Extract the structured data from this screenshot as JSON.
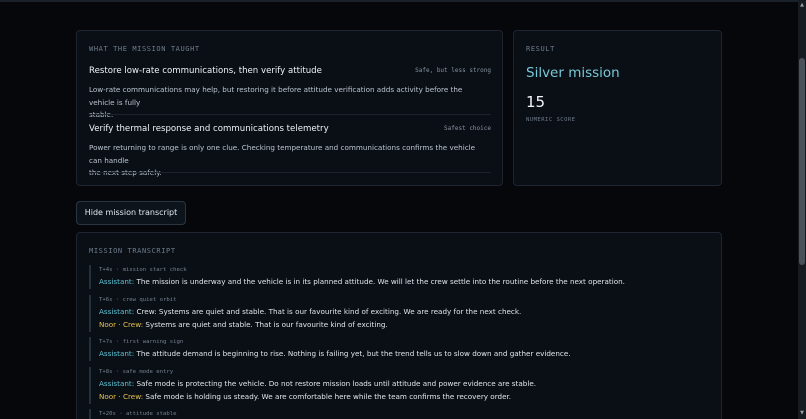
{
  "lessons_panel": {
    "label": "WHAT THE MISSION TAUGHT",
    "items": [
      {
        "title": "Restore low-rate communications, then verify attitude",
        "tag": "Safe, but less strong",
        "body_1": "Low-rate communications may help, but restoring it before attitude verification adds activity before the vehicle is fully",
        "body_2": "stable."
      },
      {
        "title": "Verify thermal response and communications telemetry",
        "tag": "Safest choice",
        "body_1": "Power returning to range is only one clue. Checking temperature and communications confirms the vehicle can handle",
        "body_2": "the next step safely."
      }
    ]
  },
  "result_panel": {
    "label": "RESULT",
    "title": "Silver mission",
    "score": "15",
    "score_label": "NUMERIC SCORE"
  },
  "transcript_toggle": {
    "label": "Hide mission transcript"
  },
  "transcript": {
    "label": "MISSION TRANSCRIPT",
    "entries": [
      {
        "time": "T+4s · mission start check",
        "lines": [
          {
            "speaker": "Assistant:",
            "text": " The mission is underway and the vehicle is in its planned attitude. We will let the crew settle into the routine before the next operation."
          }
        ]
      },
      {
        "time": "T+6s · crew quiet orbit",
        "lines": [
          {
            "speaker": "Assistant:",
            "text": " Crew: Systems are quiet and stable. That is our favourite kind of exciting. We are ready for the next check."
          },
          {
            "speaker": "Noor · Crew:",
            "text": " Systems are quiet and stable. That is our favourite kind of exciting."
          }
        ]
      },
      {
        "time": "T+7s · first warning sign",
        "lines": [
          {
            "speaker": "Assistant:",
            "text": " The attitude demand is beginning to rise. Nothing is failing yet, but the trend tells us to slow down and gather evidence."
          }
        ]
      },
      {
        "time": "T+8s · safe mode entry",
        "lines": [
          {
            "speaker": "Assistant:",
            "text": " Safe mode is protecting the vehicle. Do not restore mission loads until attitude and power evidence are stable."
          },
          {
            "speaker": "Noor · Crew:",
            "text": " Safe mode is holding us steady. We are comfortable here while the team confirms the recovery order."
          }
        ]
      },
      {
        "time": "T+20s · attitude stable",
        "lines": []
      }
    ]
  },
  "colors": {
    "assistant": "#5ec4d6",
    "crew": "#e3c24d",
    "result_title": "#79c9d9"
  }
}
